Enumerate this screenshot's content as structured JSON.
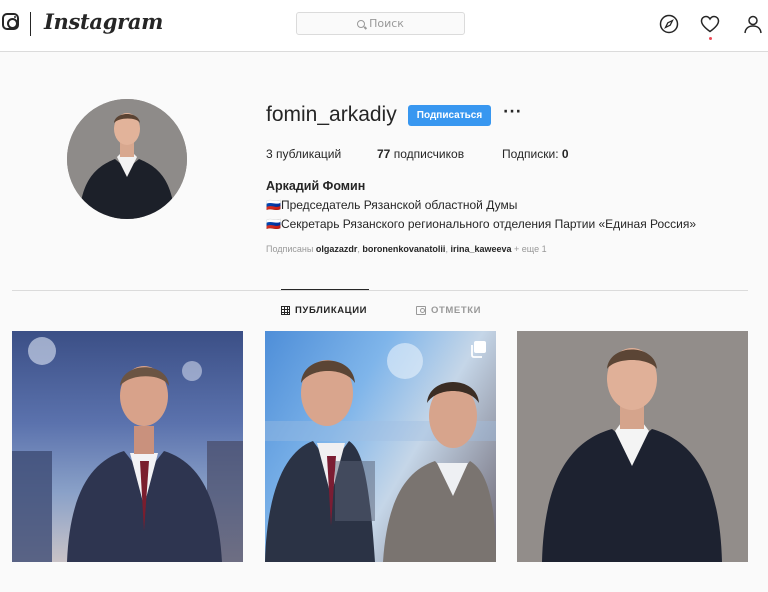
{
  "nav": {
    "brand": "Instagram",
    "search_placeholder": "Поиск",
    "icons": [
      "instagram-icon",
      "explore-icon",
      "heart-icon",
      "profile-icon"
    ]
  },
  "profile": {
    "username": "fomin_arkadiy",
    "follow_label": "Подписаться",
    "more_label": "···",
    "stats": {
      "posts_count": "3",
      "posts_label": "публикаций",
      "followers_count": "77",
      "followers_label": "подписчиков",
      "following_label": "Подписки:",
      "following_count": "0"
    },
    "full_name": "Аркадий Фомин",
    "bio_line1": "🇷🇺Председатель Рязанской областной Думы",
    "bio_line2": "🇷🇺Секретарь Рязанского регионального отделения Партии «Единая Россия»",
    "followed_by_label": "Подписаны",
    "followed_by_users": [
      "olgazazdr",
      "boronenkovanatolii",
      "irina_kaweeva"
    ],
    "followed_by_more": "+ еще 1"
  },
  "tabs": [
    {
      "label": "ПУБЛИКАЦИИ",
      "active": true
    },
    {
      "label": "ОТМЕТКИ",
      "active": false
    }
  ],
  "posts": [
    {
      "kind": "single"
    },
    {
      "kind": "carousel"
    },
    {
      "kind": "single"
    }
  ],
  "colors": {
    "accent": "#3897f0",
    "border": "#dbdbdb",
    "background": "#fafafa",
    "text": "#262626",
    "muted": "#999999",
    "notification": "#ed4956"
  }
}
